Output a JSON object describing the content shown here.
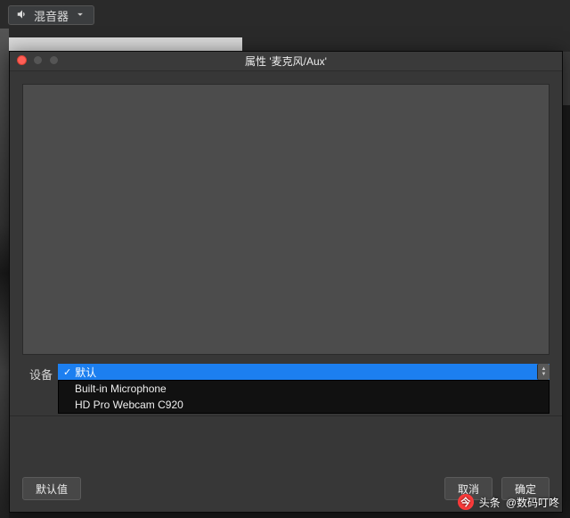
{
  "toolbar": {
    "mixer_label": "混音器"
  },
  "dialog": {
    "title": "属性 '麦克风/Aux'",
    "device_label": "设备",
    "selected": "默认",
    "options": [
      "Built-in Microphone",
      "HD Pro Webcam C920"
    ],
    "defaults_label": "默认值",
    "cancel_label": "取消",
    "ok_label": "确定"
  },
  "watermark": {
    "prefix": "头条",
    "author": "@数码叮咚"
  },
  "colors": {
    "accent": "#1c7ff0",
    "panel": "#373737",
    "dark": "#111"
  }
}
